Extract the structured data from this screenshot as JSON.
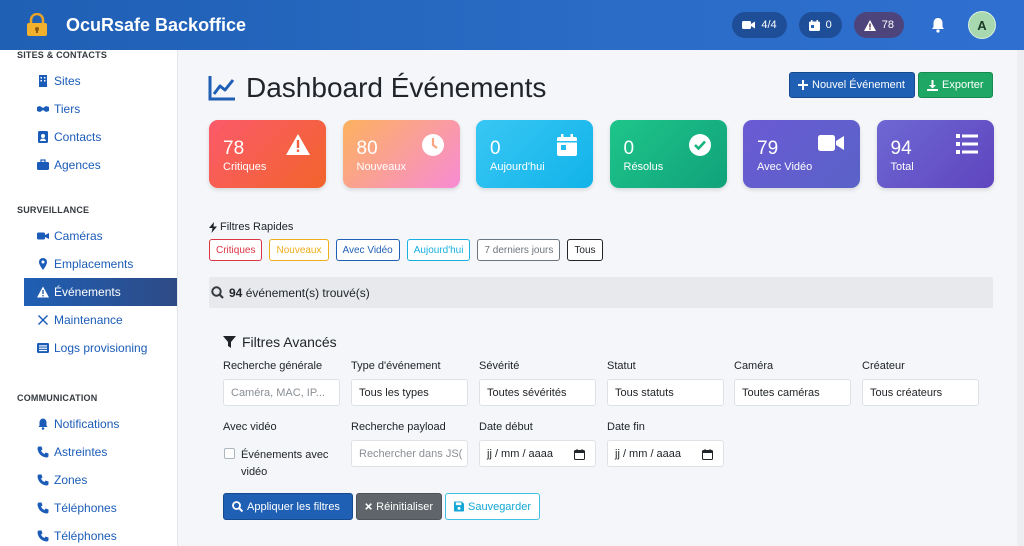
{
  "app": {
    "title": "OcuRsafe Backoffice"
  },
  "header": {
    "cameras_badge": "4/4",
    "calendar_badge": "0",
    "alerts_badge": "78",
    "avatar_initial": "A"
  },
  "sidebar": {
    "sections": [
      {
        "title": "SITES & CONTACTS",
        "items": [
          "Sites",
          "Tiers",
          "Contacts",
          "Agences"
        ]
      },
      {
        "title": "SURVEILLANCE",
        "items": [
          "Caméras",
          "Emplacements",
          "Événements",
          "Maintenance",
          "Logs provisioning"
        ]
      },
      {
        "title": "COMMUNICATION",
        "items": [
          "Notifications",
          "Astreintes",
          "Zones",
          "Téléphones",
          "Téléphones"
        ]
      }
    ],
    "active_item": "Événements"
  },
  "page": {
    "title": "Dashboard Événements",
    "new_button": "Nouvel Événement",
    "export_button": "Exporter"
  },
  "cards": [
    {
      "value": "78",
      "label": "Critiques",
      "icon": "warning-icon"
    },
    {
      "value": "80",
      "label": "Nouveaux",
      "icon": "clock-icon"
    },
    {
      "value": "0",
      "label": "Aujourd'hui",
      "icon": "calendar-icon"
    },
    {
      "value": "0",
      "label": "Résolus",
      "icon": "check-circle-icon"
    },
    {
      "value": "79",
      "label": "Avec Vidéo",
      "icon": "video-icon"
    },
    {
      "value": "94",
      "label": "Total",
      "icon": "list-icon"
    }
  ],
  "quick_filters": {
    "title": "Filtres Rapides",
    "chips": [
      {
        "label": "Critiques",
        "color": "#dc3545"
      },
      {
        "label": "Nouveaux",
        "color": "#f0ad1c"
      },
      {
        "label": "Avec Vidéo",
        "color": "#1f5fb4"
      },
      {
        "label": "Aujourd'hui",
        "color": "#17b0e0"
      },
      {
        "label": "7 derniers jours",
        "color": "#6c757d"
      },
      {
        "label": "Tous",
        "color": "#212529"
      }
    ]
  },
  "results": {
    "count": "94",
    "text": "événement(s) trouvé(s)"
  },
  "advanced": {
    "title": "Filtres Avancés",
    "search_label": "Recherche générale",
    "search_placeholder": "Caméra, MAC, IP...",
    "type_label": "Type d'événement",
    "type_value": "Tous les types",
    "severity_label": "Sévérité",
    "severity_value": "Toutes sévérités",
    "status_label": "Statut",
    "status_value": "Tous statuts",
    "camera_label": "Caméra",
    "camera_value": "Toutes caméras",
    "creator_label": "Créateur",
    "creator_value": "Tous créateurs",
    "video_label": "Avec vidéo",
    "video_checkbox_label": "Événements avec vidéo",
    "payload_label": "Recherche payload",
    "payload_placeholder": "Rechercher dans JS(",
    "date_start_label": "Date début",
    "date_start_placeholder": "jj / mm / aaaa",
    "date_end_label": "Date fin",
    "date_end_placeholder": "jj / mm / aaaa",
    "apply_button": "Appliquer les filtres",
    "reset_button": "Réinitialiser",
    "save_button": "Sauvegarder"
  }
}
